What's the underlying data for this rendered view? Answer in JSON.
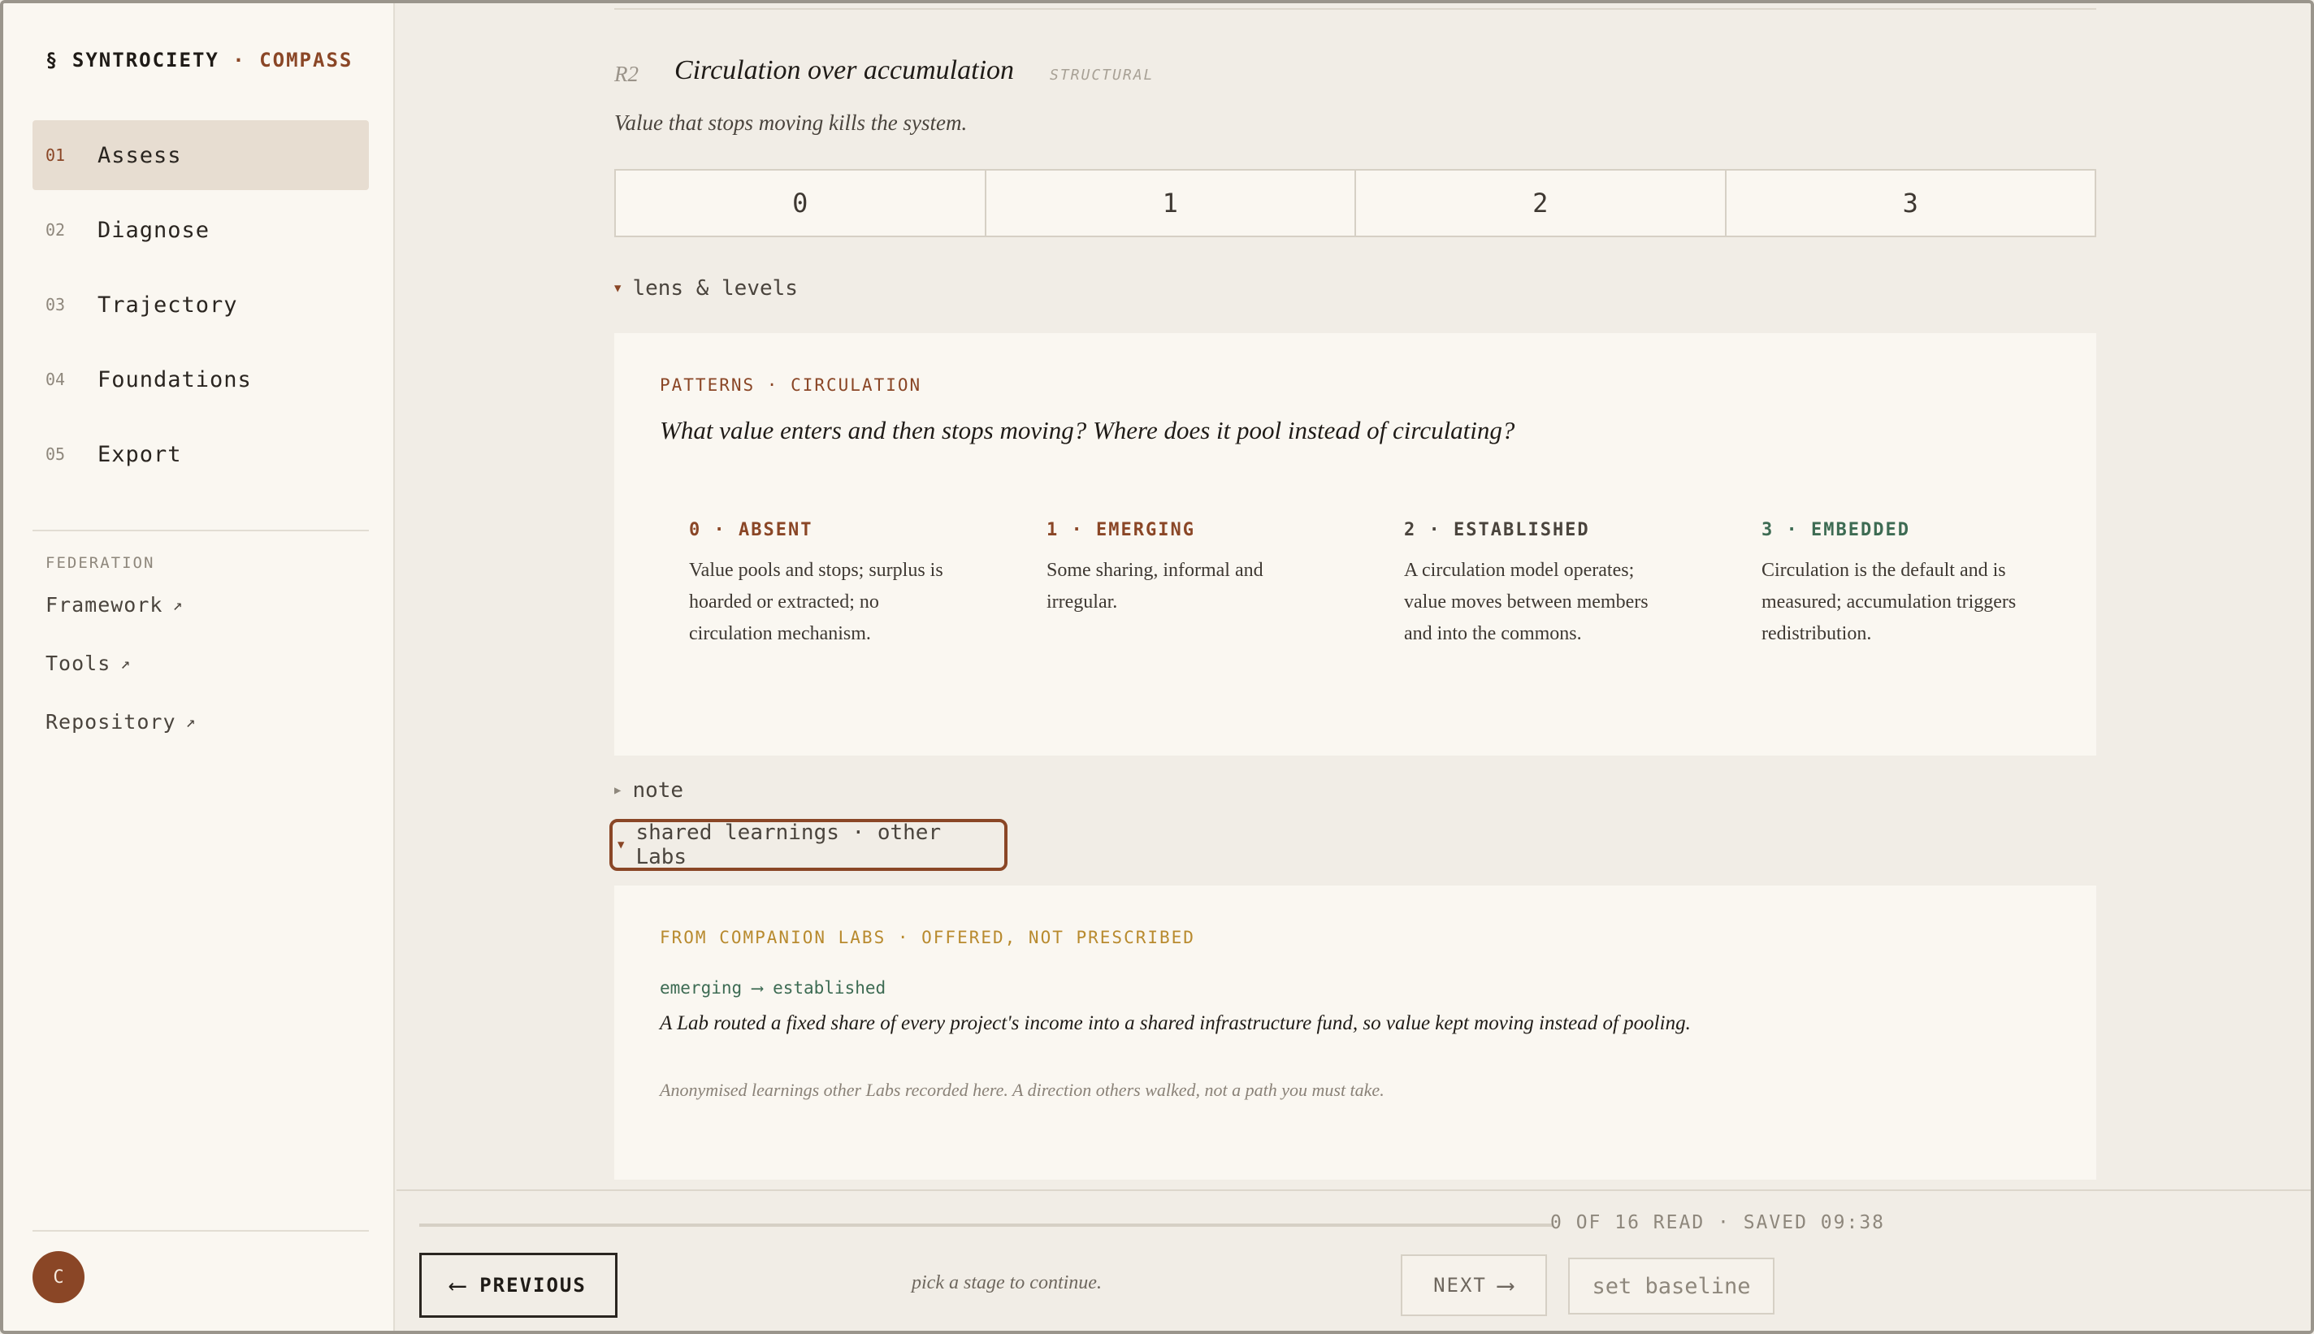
{
  "brand": {
    "prefix": "§ SYNTROCIETY",
    "dot": " · ",
    "accent": "COMPASS"
  },
  "nav": [
    {
      "num": "01",
      "label": "Assess",
      "active": true
    },
    {
      "num": "02",
      "label": "Diagnose"
    },
    {
      "num": "03",
      "label": "Trajectory"
    },
    {
      "num": "04",
      "label": "Foundations"
    },
    {
      "num": "05",
      "label": "Export"
    }
  ],
  "federation": {
    "title": "FEDERATION",
    "links": [
      {
        "label": "Framework",
        "icon": "external-link-icon",
        "glyph": "↗"
      },
      {
        "label": "Tools",
        "icon": "external-link-icon",
        "glyph": "↗"
      },
      {
        "label": "Repository",
        "icon": "external-link-icon",
        "glyph": "↗"
      }
    ]
  },
  "avatar": {
    "initial": "C"
  },
  "criterion": {
    "code": "R2",
    "title": "Circulation over accumulation",
    "tag": "STRUCTURAL",
    "subtitle": "Value that stops moving kills the system.",
    "scale": [
      "0",
      "1",
      "2",
      "3"
    ]
  },
  "lens": {
    "toggle_label": "lens & levels",
    "kicker": "PATTERNS · CIRCULATION",
    "question": "What value enters and then stops moving? Where does it pool instead of circulating?",
    "levels": [
      {
        "heading": "0 · ABSENT",
        "text": "Value pools and stops; surplus is hoarded or extracted; no circulation mechanism."
      },
      {
        "heading": "1 · EMERGING",
        "text": "Some sharing, informal and irregular."
      },
      {
        "heading": "2 · ESTABLISHED",
        "text": "A circulation model operates; value moves between members and into the commons."
      },
      {
        "heading": "3 · EMBEDDED",
        "text": "Circulation is the default and is measured; accumulation triggers redistribution."
      }
    ]
  },
  "note": {
    "toggle_label": "note"
  },
  "shared": {
    "toggle_label": "shared learnings · other Labs",
    "kicker": "FROM COMPANION LABS · OFFERED, NOT PRESCRIBED",
    "transition": "emerging ⟶ established",
    "quote": "A Lab routed a fixed share of every project's income into a shared infrastructure fund, so value kept moving instead of pooling.",
    "footnote": "Anonymised learnings other Labs recorded here. A direction others walked, not a path you must take."
  },
  "footer": {
    "status": "0 OF 16 READ  · SAVED 09:38",
    "progress": 0,
    "previous_label": "PREVIOUS",
    "previous_arrow": "⟵",
    "hint": "pick a stage to continue.",
    "next_label": "NEXT",
    "next_arrow": "⟶",
    "baseline_label": "set baseline"
  },
  "colors": {
    "accent": "#8a4626",
    "gold": "#b88a2e",
    "green": "#3d6b53",
    "bg": "#f1ede6",
    "panel": "#faf7f1"
  }
}
